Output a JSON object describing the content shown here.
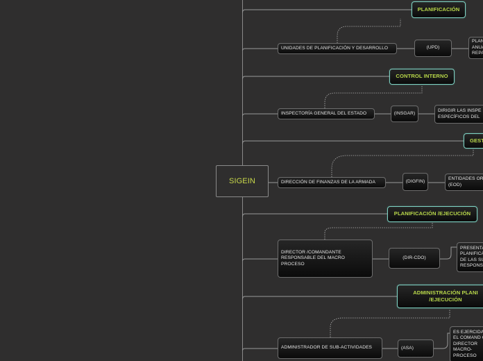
{
  "root": {
    "label": "SIGEIN"
  },
  "colors": {
    "category_text": "#b9d84a",
    "category_border": "#7ed3c4",
    "root_text": "#c9d94a",
    "line": "#9a9a9a",
    "background": "#2f2e2e"
  },
  "branches": [
    {
      "category": "PLANIFICACIÓN",
      "entity": "UNIDADES DE PLANIFICACIÓN Y DESARROLLO",
      "code": "(UPD)",
      "description": "PLAN ANUAL REPA"
    },
    {
      "category": "CONTROL INTERNO",
      "entity": "INSPECTORÍA GENERAL DEL ESTADO",
      "code": "(INSGAR)",
      "description": "DIRIGIR LAS INSPE ESPECÍFICOS DEL"
    },
    {
      "category": "GEST",
      "entity": "DIRECCIÓN DE FINANZAS DE LA ARMADA",
      "code": "(DIGFIN)",
      "description": "ENTIDADES OR (EOD)"
    },
    {
      "category": "PLANIFICACIÓN /EJECUCIÓN",
      "entity": "DIRECTOR /COMANDANTE RESPONSABLE DEL MACRO PROCESO",
      "code": "(DIR-CDO)",
      "description": "PRESENTA PLANIFICA DE LAS SU RESPONS"
    },
    {
      "category": "ADMINISTRACIÓN PLANI /EJECUCIÓN",
      "entity": "ADMINISTRADOR DE SUB-ACTIVIDADES",
      "code": "(ASA)",
      "description": "ES EJERCIDA EL COMAND O DIRECTOR MACRO- PROCESO"
    }
  ]
}
